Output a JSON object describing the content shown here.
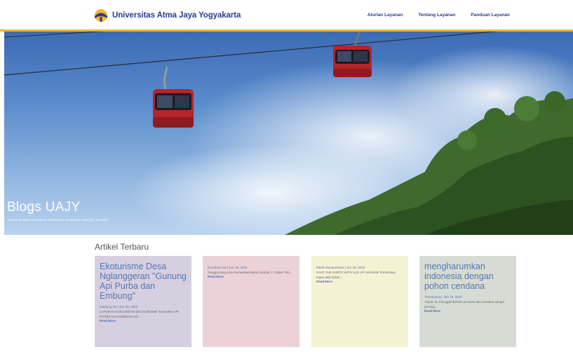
{
  "header": {
    "brand_name": "Universitas Atma Jaya Yogyakarta",
    "nav": [
      "Alurlan Layanan",
      "Tentang Layanan",
      "Panduan Layanan"
    ]
  },
  "hero": {
    "title": "Blogs UAJY",
    "subtitle": "a place to share experience, information, knowledge, learning, and skills"
  },
  "section": {
    "title": "Artikel Terbaru"
  },
  "articles": [
    {
      "title": "Ekoturisme Desa Nglanggeran \"Gunung Api Purba dan Embung\"",
      "meta": "asadong mk | Jun 20, 2015",
      "excerpt": "LAPORAN KUNJUNGAN EKOTURISME \"GUNUNG API PURBA DAN EMBUNG NG...",
      "more": "Read More",
      "color": "#d6cfe0"
    },
    {
      "title": "",
      "meta": "yunahsari.sal | Jun 19, 2015",
      "excerpt": "Tanggal yang Kita memanfaat Baral Gambar 1: Pohon Teh...",
      "more": "Read More",
      "color": "#ecd1d7"
    },
    {
      "title": "",
      "meta": "Martin Bonaventura | Jun 19, 2015",
      "excerpt": "SAVE THE EARTH WITH ACE OF HEAVEN! Enrivestasi tugas akai kuliah...",
      "more": "Read More",
      "color": "#f5f1d3"
    },
    {
      "title": "mengharumkan indonesia dengan pohon cendana",
      "meta": "Tennokosoy | Jun 19, 2015",
      "excerpt": "Tujuan itu menggambarkan peranan lalu cendana sangat penting...",
      "more": "Read More",
      "color": "#d6dcd3"
    }
  ]
}
